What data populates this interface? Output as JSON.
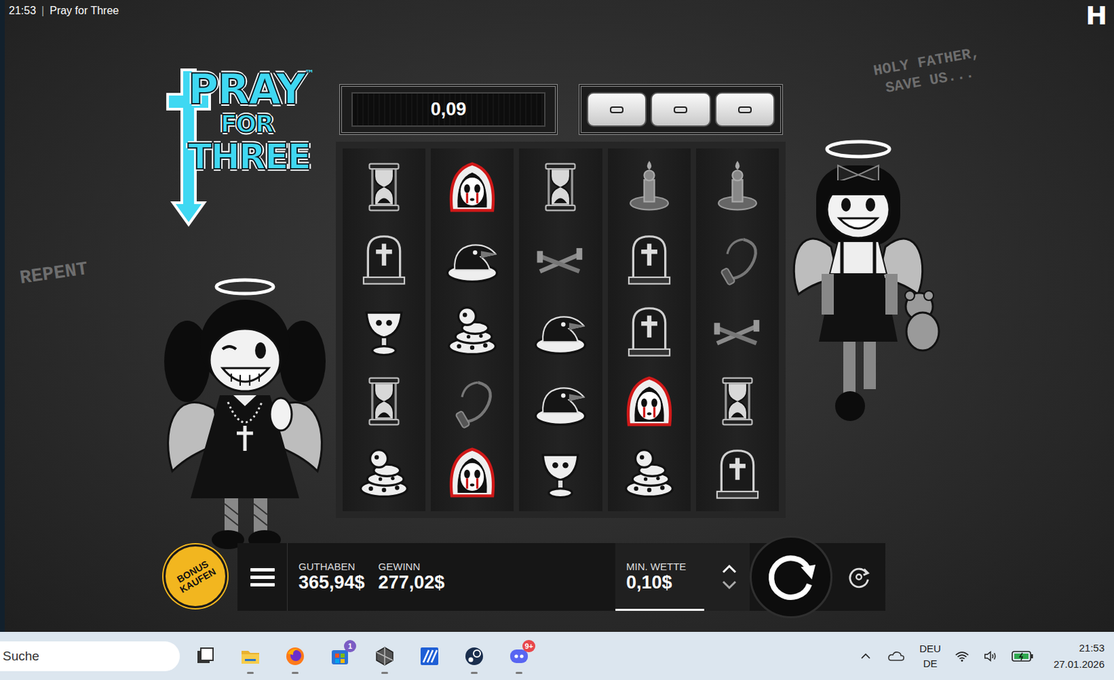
{
  "window": {
    "time": "21:53",
    "separator": "|",
    "title": "Pray for Three"
  },
  "brand_logo": "H",
  "game_logo": {
    "lines": [
      "PRAY",
      "FOR",
      "THREE"
    ],
    "trademark": "™"
  },
  "graffiti": [
    {
      "lines": [
        "HOLY FATHER,",
        "SAVE US..."
      ]
    },
    {
      "lines": [
        "REPENT"
      ]
    }
  ],
  "win_display": "0,09",
  "indicators": [
    {
      "active": false
    },
    {
      "active": false
    },
    {
      "active": false
    }
  ],
  "reels": [
    {
      "symbols": [
        {
          "kind": "hourglass"
        },
        {
          "kind": "tombstone"
        },
        {
          "kind": "chalice"
        },
        {
          "kind": "hourglass"
        },
        {
          "kind": "snake"
        }
      ]
    },
    {
      "symbols": [
        {
          "kind": "nun"
        },
        {
          "kind": "crow"
        },
        {
          "kind": "snake"
        },
        {
          "kind": "whip"
        },
        {
          "kind": "nun"
        }
      ]
    },
    {
      "symbols": [
        {
          "kind": "hourglass"
        },
        {
          "kind": "nails"
        },
        {
          "kind": "crow"
        },
        {
          "kind": "crow"
        },
        {
          "kind": "chalice"
        }
      ]
    },
    {
      "symbols": [
        {
          "kind": "candle"
        },
        {
          "kind": "tombstone"
        },
        {
          "kind": "tombstone"
        },
        {
          "kind": "nun"
        },
        {
          "kind": "snake"
        }
      ]
    },
    {
      "symbols": [
        {
          "kind": "candle"
        },
        {
          "kind": "whip"
        },
        {
          "kind": "nails"
        },
        {
          "kind": "hourglass"
        },
        {
          "kind": "tombstone"
        }
      ]
    }
  ],
  "bonus_button": {
    "lines": [
      "BONUS",
      "KAUFEN"
    ]
  },
  "balance": {
    "label": "GUTHABEN",
    "value": "365,94$"
  },
  "win": {
    "label": "GEWINN",
    "value": "277,02$"
  },
  "bet": {
    "label": "MIN. WETTE",
    "value": "0,10$",
    "level": 0.66
  },
  "taskbar": {
    "search": {
      "placeholder": "Suche"
    },
    "apps": [
      {
        "kind": "taskview",
        "running": false,
        "badge": null
      },
      {
        "kind": "folder",
        "running": true,
        "badge": null
      },
      {
        "kind": "firefox",
        "running": true,
        "badge": null
      },
      {
        "kind": "store",
        "running": false,
        "badge": "1"
      },
      {
        "kind": "hexapp",
        "running": true,
        "badge": null
      },
      {
        "kind": "blueapp",
        "running": false,
        "badge": null
      },
      {
        "kind": "steam",
        "running": true,
        "badge": null
      },
      {
        "kind": "discord",
        "running": true,
        "badge": "9+"
      }
    ],
    "tray": {
      "language": [
        "DEU",
        "DE"
      ],
      "time": "21:53",
      "date": "27.01.2026"
    }
  }
}
